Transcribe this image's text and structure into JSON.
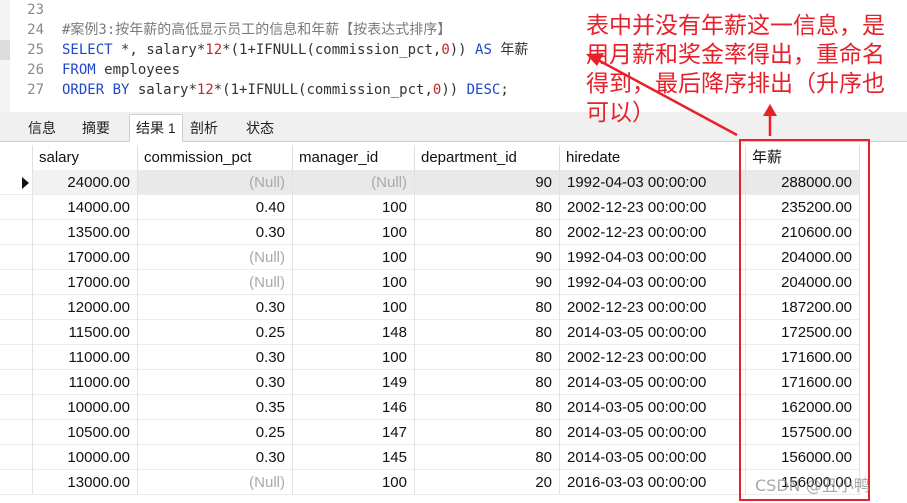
{
  "editor": {
    "lines": [
      {
        "no": "23",
        "text": ""
      },
      {
        "no": "24",
        "text": "#案例3:按年薪的高低显示员工的信息和年薪【按表达式排序】"
      },
      {
        "no": "25",
        "p1": "SELECT",
        "p2": " *, salary*",
        "p3": "12",
        "p4": "*(1+IFNULL(commission_pct,",
        "p5": "0",
        "p6": ")) ",
        "p7": "AS",
        "p8": " 年薪"
      },
      {
        "no": "26",
        "p1": "FROM",
        "p2": " employees"
      },
      {
        "no": "27",
        "p1": "ORDER BY",
        "p2": " salary*",
        "p3": "12",
        "p4": "*(1+IFNULL(commission_pct,",
        "p5": "0",
        "p6": ")) ",
        "p7": "DESC",
        "p8": ";"
      }
    ]
  },
  "tabs": [
    {
      "label": "信息",
      "active": false
    },
    {
      "label": "摘要",
      "active": false
    },
    {
      "label": "结果 1",
      "active": true
    },
    {
      "label": "剖析",
      "active": false
    },
    {
      "label": "状态",
      "active": false
    }
  ],
  "grid": {
    "columns": [
      "salary",
      "commission_pct",
      "manager_id",
      "department_id",
      "hiredate",
      "年薪"
    ],
    "rows": [
      [
        "24000.00",
        "(Null)",
        "(Null)",
        "90",
        "1992-04-03 00:00:00",
        "288000.00"
      ],
      [
        "14000.00",
        "0.40",
        "100",
        "80",
        "2002-12-23 00:00:00",
        "235200.00"
      ],
      [
        "13500.00",
        "0.30",
        "100",
        "80",
        "2002-12-23 00:00:00",
        "210600.00"
      ],
      [
        "17000.00",
        "(Null)",
        "100",
        "90",
        "1992-04-03 00:00:00",
        "204000.00"
      ],
      [
        "17000.00",
        "(Null)",
        "100",
        "90",
        "1992-04-03 00:00:00",
        "204000.00"
      ],
      [
        "12000.00",
        "0.30",
        "100",
        "80",
        "2002-12-23 00:00:00",
        "187200.00"
      ],
      [
        "11500.00",
        "0.25",
        "148",
        "80",
        "2014-03-05 00:00:00",
        "172500.00"
      ],
      [
        "11000.00",
        "0.30",
        "100",
        "80",
        "2002-12-23 00:00:00",
        "171600.00"
      ],
      [
        "11000.00",
        "0.30",
        "149",
        "80",
        "2014-03-05 00:00:00",
        "171600.00"
      ],
      [
        "10000.00",
        "0.35",
        "146",
        "80",
        "2014-03-05 00:00:00",
        "162000.00"
      ],
      [
        "10500.00",
        "0.25",
        "147",
        "80",
        "2014-03-05 00:00:00",
        "157500.00"
      ],
      [
        "10000.00",
        "0.30",
        "145",
        "80",
        "2014-03-05 00:00:00",
        "156000.00"
      ],
      [
        "13000.00",
        "(Null)",
        "100",
        "20",
        "2016-03-03 00:00:00",
        "156000.00"
      ]
    ],
    "selected_row": 0
  },
  "annotation": {
    "text": "表中并没有年薪这一信息，是用月薪和奖金率得出，重命名得到，最后降序排出（升序也可以）",
    "color": "#e8202a"
  },
  "watermark": "CSDN @丑小鸭"
}
